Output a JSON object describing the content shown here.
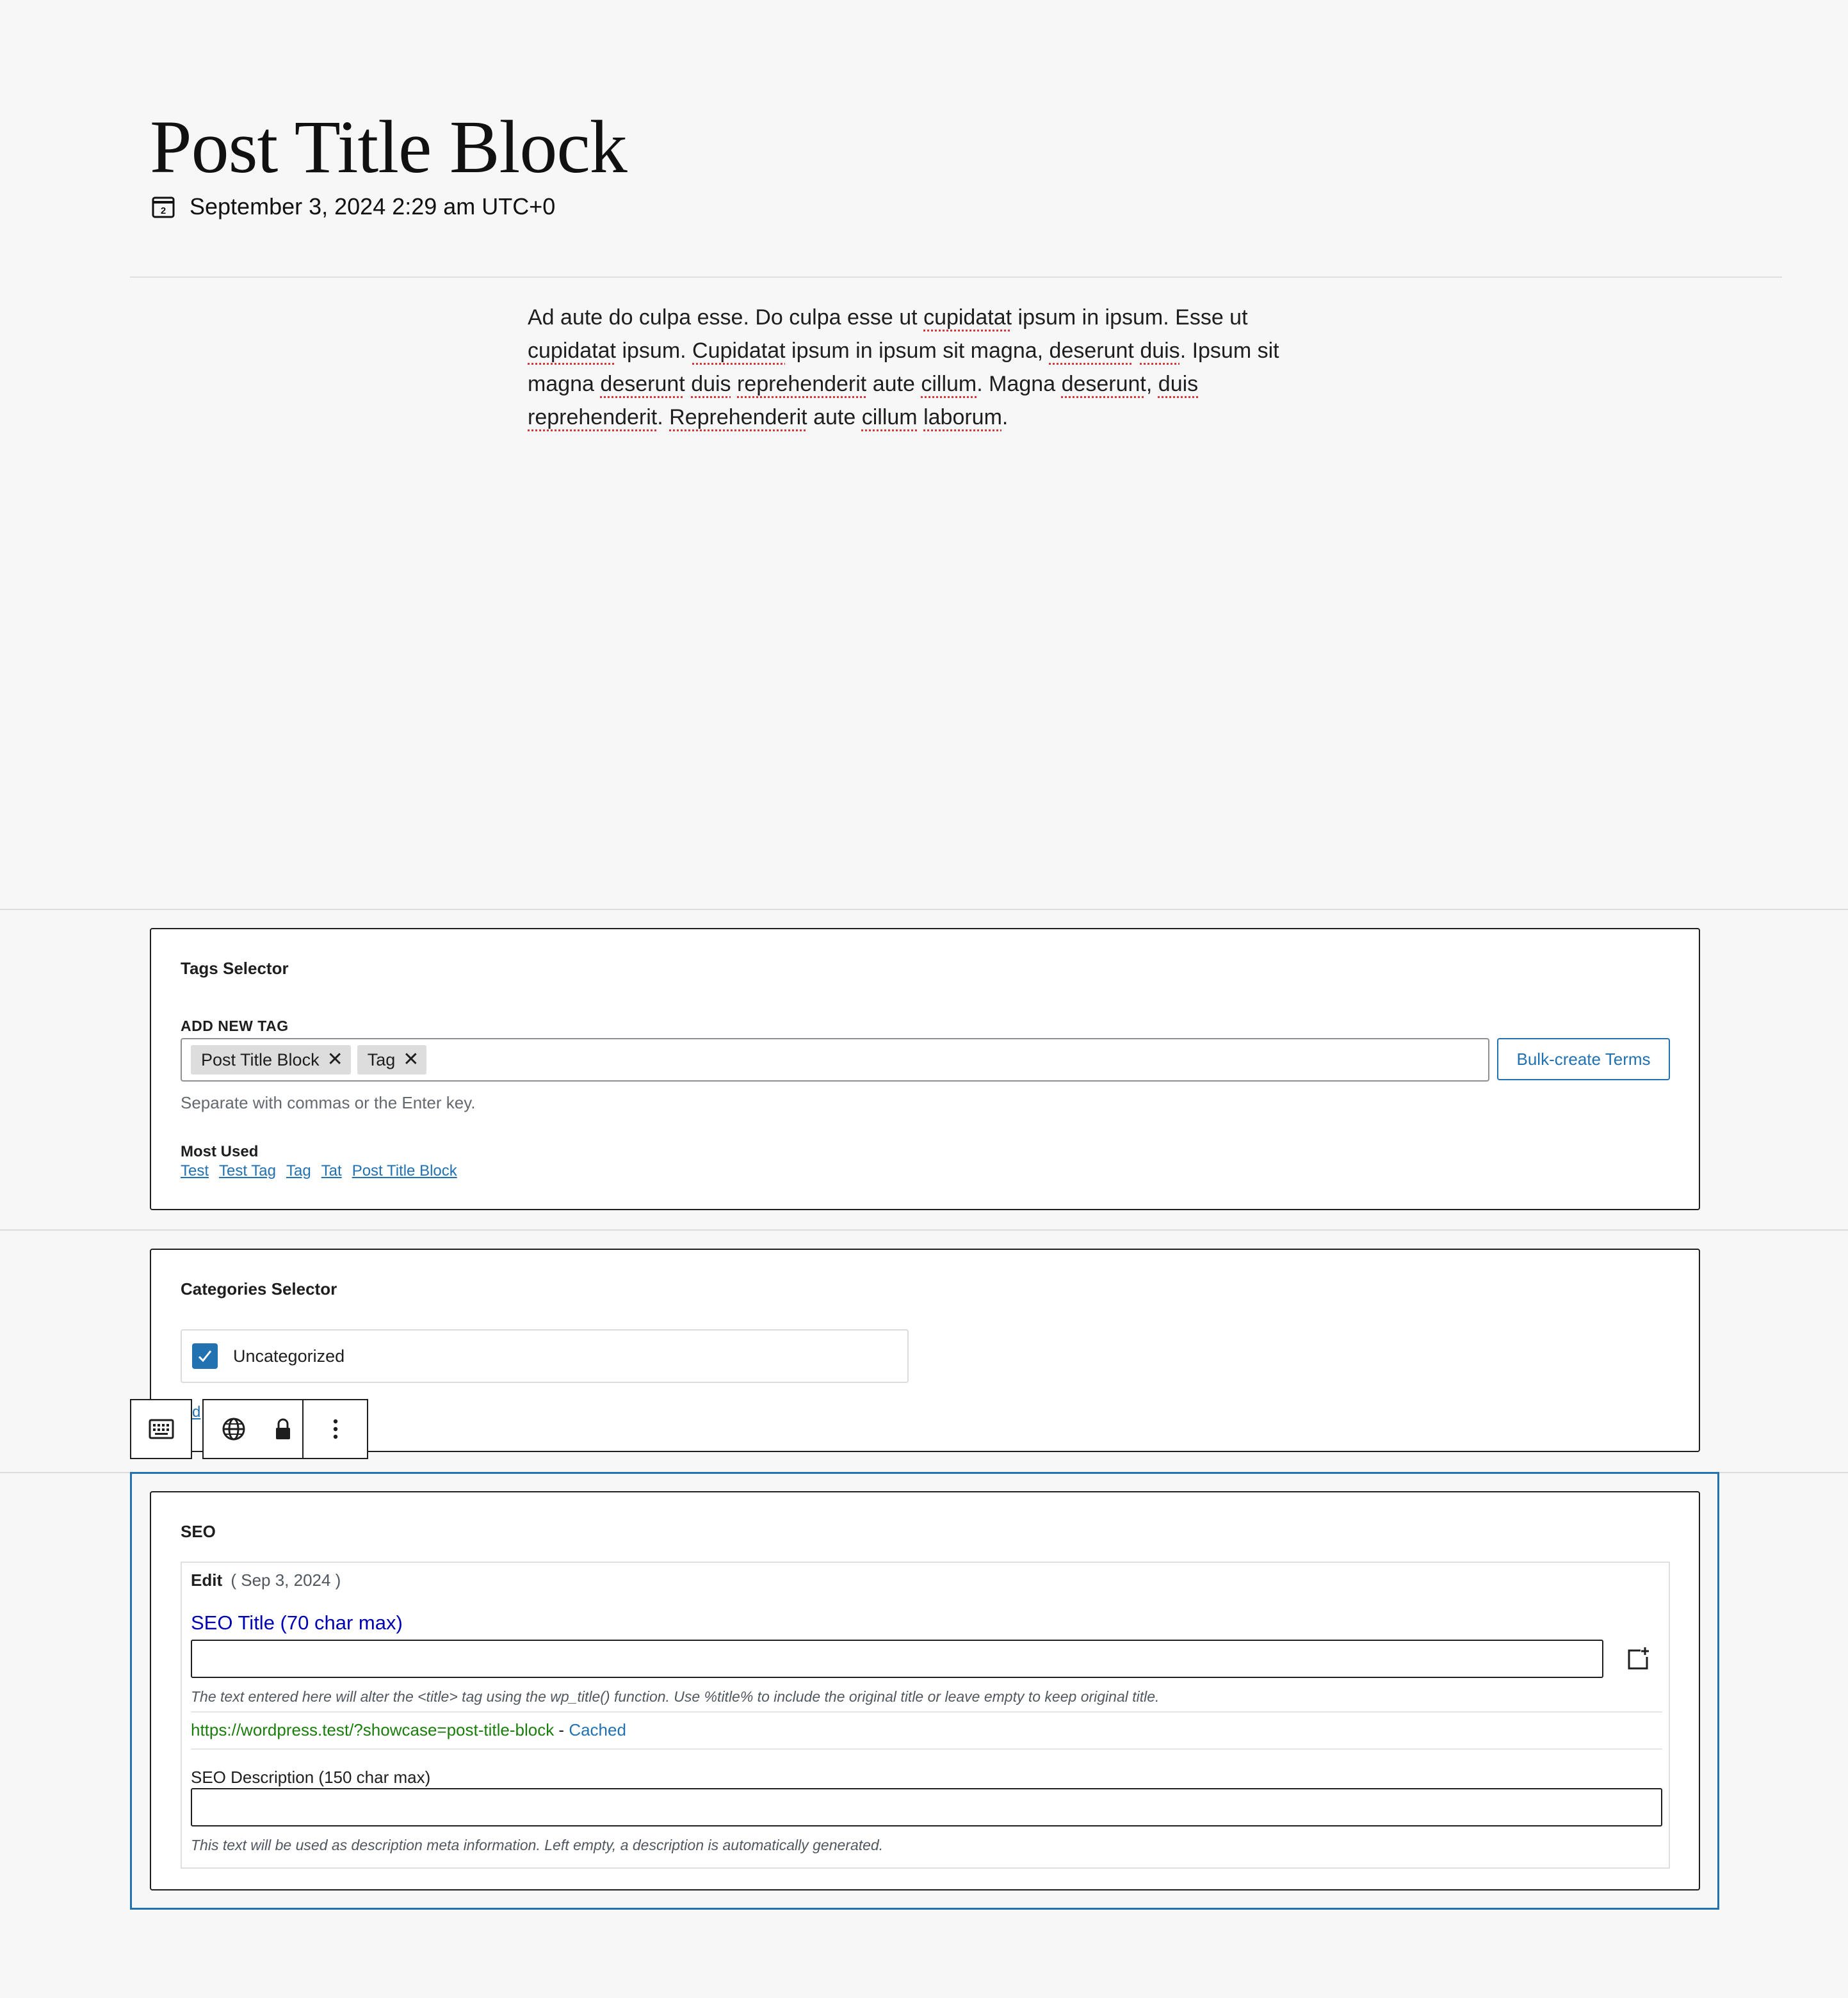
{
  "post": {
    "title": "Post Title Block",
    "date": "September 3, 2024 2:29 am UTC+0",
    "calendar_day": "2",
    "content": [
      {
        "t": "Ad aute do culpa esse. Do culpa esse ut ",
        "s": false
      },
      {
        "t": "cupidatat",
        "s": true
      },
      {
        "t": " ipsum in ipsum. Esse ut ",
        "s": false
      },
      {
        "t": "cupidatat",
        "s": true
      },
      {
        "t": " ipsum. ",
        "s": false
      },
      {
        "t": "Cupidatat",
        "s": true
      },
      {
        "t": " ipsum in ipsum sit magna, ",
        "s": false
      },
      {
        "t": "deserunt",
        "s": true
      },
      {
        "t": " ",
        "s": false
      },
      {
        "t": "duis",
        "s": true
      },
      {
        "t": ". Ipsum sit magna ",
        "s": false
      },
      {
        "t": "deserunt",
        "s": true
      },
      {
        "t": " ",
        "s": false
      },
      {
        "t": "duis",
        "s": true
      },
      {
        "t": " ",
        "s": false
      },
      {
        "t": "reprehenderit",
        "s": true
      },
      {
        "t": " aute ",
        "s": false
      },
      {
        "t": "cillum",
        "s": true
      },
      {
        "t": ". Magna ",
        "s": false
      },
      {
        "t": "deserunt",
        "s": true
      },
      {
        "t": ", ",
        "s": false
      },
      {
        "t": "duis",
        "s": true
      },
      {
        "t": " ",
        "s": false
      },
      {
        "t": "reprehenderit",
        "s": true
      },
      {
        "t": ". ",
        "s": false
      },
      {
        "t": "Reprehenderit",
        "s": true
      },
      {
        "t": " aute ",
        "s": false
      },
      {
        "t": "cillum",
        "s": true
      },
      {
        "t": " ",
        "s": false
      },
      {
        "t": "laborum",
        "s": true
      },
      {
        "t": ".",
        "s": false
      }
    ]
  },
  "tags": {
    "title": "Tags Selector",
    "add_label": "ADD NEW TAG",
    "tokens": [
      "Post Title Block",
      "Tag"
    ],
    "remove_glyph": "✕",
    "bulk_button": "Bulk-create Terms",
    "help": "Separate with commas or the Enter key.",
    "most_used_label": "Most Used",
    "most_used": [
      "Test",
      "Test Tag",
      "Tag",
      "Tat",
      "Post Title Block"
    ]
  },
  "categories": {
    "title": "Categories Selector",
    "items": [
      {
        "label": "Uncategorized",
        "checked": true
      }
    ],
    "add_link_partial": "d"
  },
  "toolbar": {
    "icons": [
      "keyboard-icon",
      "globe-icon",
      "lock-icon",
      "more-vertical-icon"
    ]
  },
  "seo": {
    "title": "SEO",
    "edit_label": "Edit",
    "edit_date": "( Sep 3, 2024 )",
    "seo_title_label": "SEO Title (70 char max)",
    "seo_title_value": "",
    "seo_title_help": "The text entered here will alter the <title> tag using the wp_title() function. Use %title% to include the original title or leave empty to keep original title.",
    "url": "https://wordpress.test/?showcase=post-title-block",
    "url_separator": " - ",
    "cached_label": "Cached",
    "desc_label": "SEO Description (150 char max)",
    "desc_value": "",
    "desc_help": "This text will be used as description meta information. Left empty, a description is automatically generated."
  },
  "colors": {
    "accent": "#2271b1",
    "link_blue": "#0000b3",
    "url_green": "#1a7d0c",
    "spell_red": "#d63638"
  }
}
